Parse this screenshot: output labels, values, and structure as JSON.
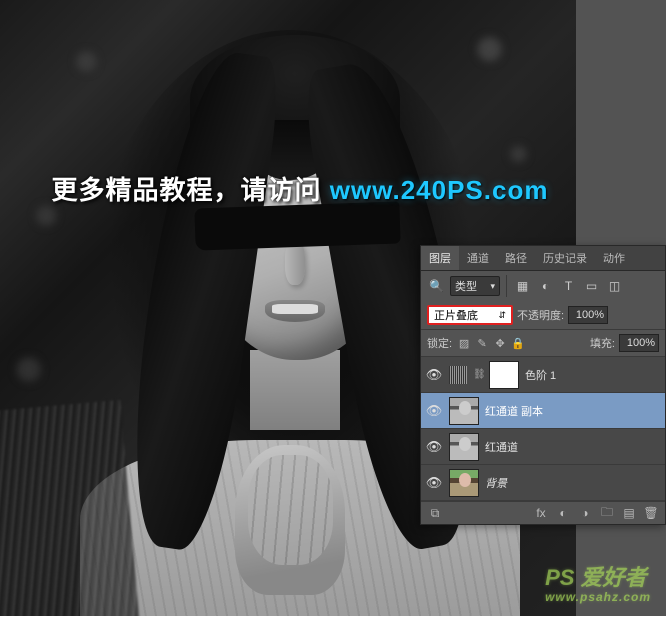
{
  "overlay": {
    "text_cn": "更多精品教程，请访问 ",
    "url": "www.240PS.com"
  },
  "watermark": {
    "brand": "PS 爱好者",
    "site": "www.psahz.com"
  },
  "panel": {
    "tabs": [
      "图层",
      "通道",
      "路径",
      "历史记录",
      "动作"
    ],
    "active_tab": 0,
    "kind_label": "类型",
    "blend_mode": "正片叠底",
    "opacity_label": "不透明度:",
    "opacity_value": "100%",
    "lock_label": "锁定:",
    "fill_label": "填充:",
    "fill_value": "100%",
    "layers": [
      {
        "visible": true,
        "type": "adjustment",
        "name": "色阶 1",
        "selected": false
      },
      {
        "visible": true,
        "type": "portrait",
        "name": "红通道 副本",
        "selected": true
      },
      {
        "visible": true,
        "type": "portrait",
        "name": "红通道",
        "selected": false
      },
      {
        "visible": true,
        "type": "color",
        "name": "背景",
        "italic": true,
        "selected": false
      }
    ]
  }
}
